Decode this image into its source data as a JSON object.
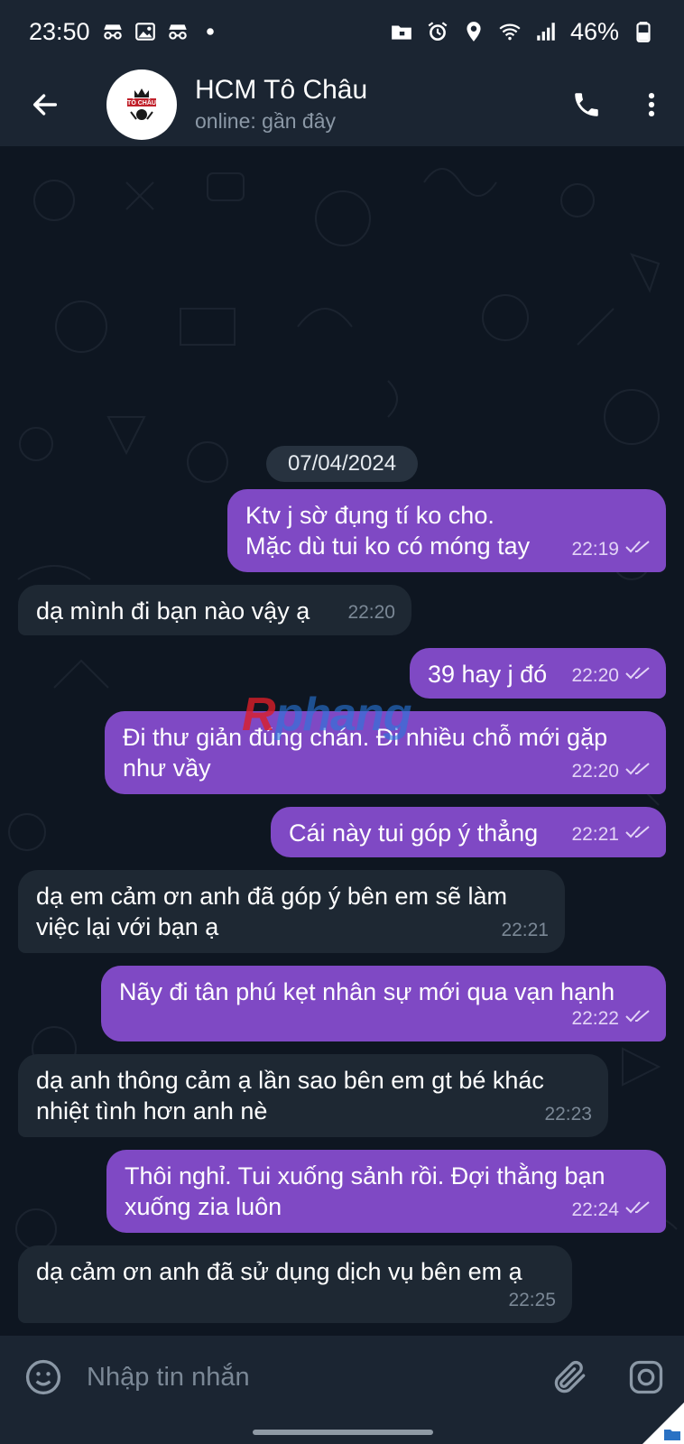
{
  "status_bar": {
    "time": "23:50",
    "battery": "46%",
    "icons_left": [
      "incognito-icon",
      "image-icon",
      "incognito-icon",
      "dot-icon"
    ],
    "icons_right": [
      "folder-lock-icon",
      "alarm-icon",
      "location-icon",
      "wifi-icon",
      "signal-icon",
      "battery-icon"
    ]
  },
  "header": {
    "name": "HCM Tô Châu",
    "status": "online: gần đây",
    "avatar_text": "TÔ CHÂU"
  },
  "date_separator": "07/04/2024",
  "messages": [
    {
      "dir": "out",
      "lines": [
        "Ktv j sờ đụng tí ko cho.",
        "Mặc dù tui ko có móng tay"
      ],
      "time": "22:19"
    },
    {
      "dir": "in",
      "lines": [
        "dạ mình đi bạn nào vậy ạ"
      ],
      "time": "22:20"
    },
    {
      "dir": "out",
      "lines": [
        "39 hay j đó"
      ],
      "time": "22:20"
    },
    {
      "dir": "out",
      "lines": [
        "Đi thư giản đúng chán. Đi nhiều chỗ mới gặp",
        "như vầy"
      ],
      "time": "22:20"
    },
    {
      "dir": "out",
      "lines": [
        "Cái này tui góp ý thẳng"
      ],
      "time": "22:21"
    },
    {
      "dir": "in",
      "lines": [
        "dạ em cảm ơn anh đã góp ý bên em sẽ làm",
        "việc lại với bạn ạ"
      ],
      "time": "22:21"
    },
    {
      "dir": "out",
      "lines": [
        "Nãy đi tân phú kẹt nhân sự mới qua vạn hạnh"
      ],
      "time": "22:22"
    },
    {
      "dir": "in",
      "lines": [
        "dạ anh thông cảm ạ lần sao bên em gt bé khác",
        "nhiệt tình hơn anh nè"
      ],
      "time": "22:23"
    },
    {
      "dir": "out",
      "lines": [
        "Thôi nghỉ. Tui xuống sảnh rồi. Đợi thằng bạn",
        "xuống zia luôn"
      ],
      "time": "22:24"
    },
    {
      "dir": "in",
      "lines": [
        "dạ cảm ơn anh đã sử dụng dịch vụ bên em ạ"
      ],
      "time": "22:25"
    }
  ],
  "watermark": {
    "r": "R",
    "rest": "phang"
  },
  "composer": {
    "placeholder": "Nhập tin nhắn"
  },
  "colors": {
    "outgoing_bubble": "#7f49c4",
    "incoming_bubble": "#1e2833",
    "background": "#0e1621",
    "bar": "#1b2532"
  }
}
